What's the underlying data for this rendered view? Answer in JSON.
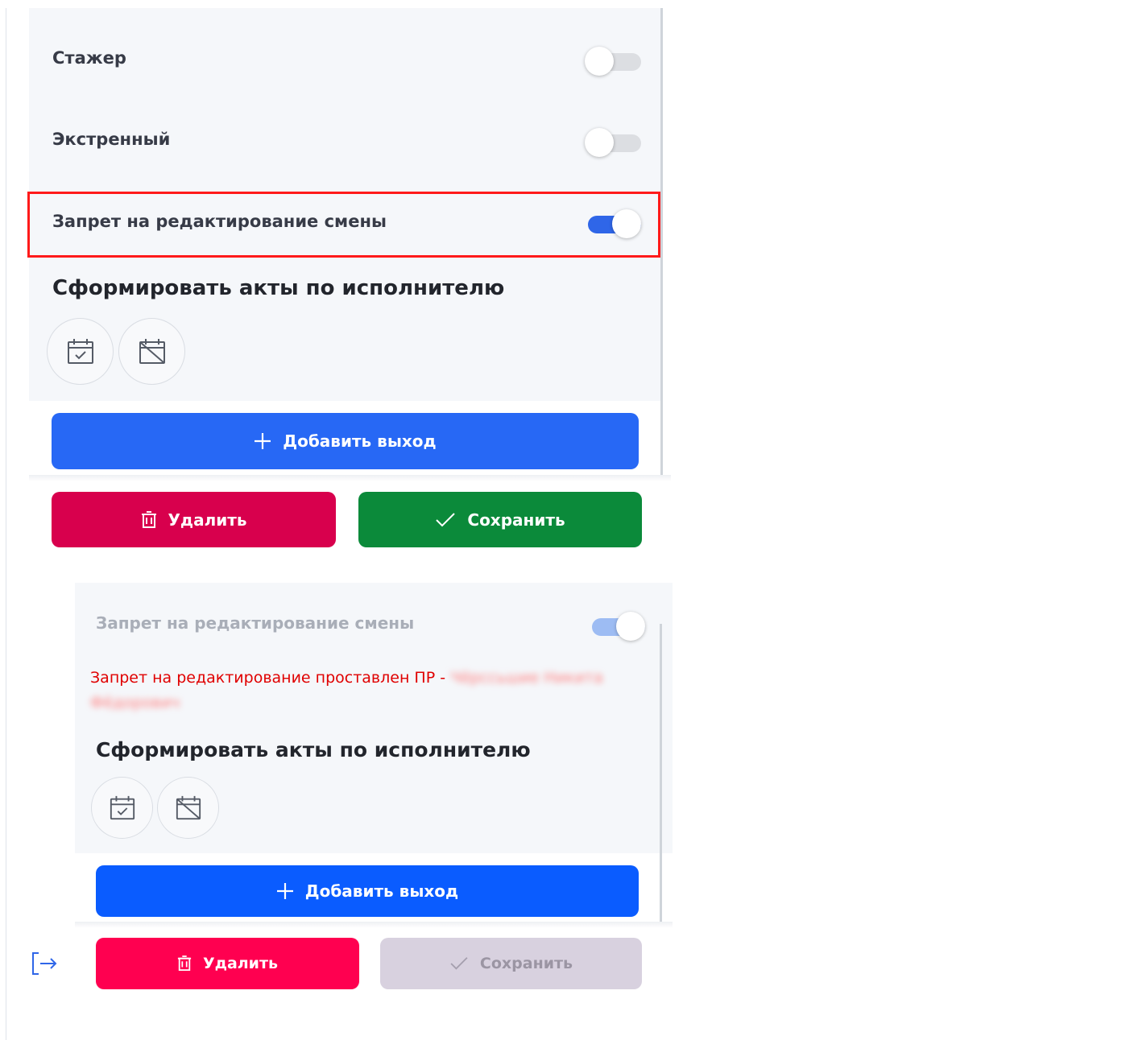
{
  "top": {
    "rows": [
      {
        "label": "Стажер",
        "toggle": "off"
      },
      {
        "label": "Экстренный",
        "toggle": "off"
      },
      {
        "label": "Запрет на редактирование смены",
        "toggle": "on"
      }
    ],
    "section_title": "Сформировать акты по исполнителю",
    "add_exit_label": "Добавить выход",
    "delete_label": "Удалить",
    "save_label": "Сохранить"
  },
  "bottom": {
    "row": {
      "label": "Запрет на редактирование смены",
      "toggle": "on"
    },
    "warning": "Запрет на редактирование проставлен ПР - ",
    "warning_name_line1": "Чёрссьшие Никита",
    "warning_name_line2": "Фёдорович",
    "section_title": "Сформировать акты по исполнителю",
    "add_exit_label": "Добавить выход",
    "delete_label": "Удалить",
    "save_label": "Сохранить"
  },
  "colors": {
    "accent_blue": "#2768f5",
    "delete_red": "#d8004d",
    "save_green": "#0b8a3a",
    "highlight_red": "#ff1a1a"
  },
  "icons": [
    "calendar-check-icon",
    "calendar-cross-icon",
    "plus-icon",
    "trash-icon",
    "check-icon",
    "logout-icon"
  ]
}
